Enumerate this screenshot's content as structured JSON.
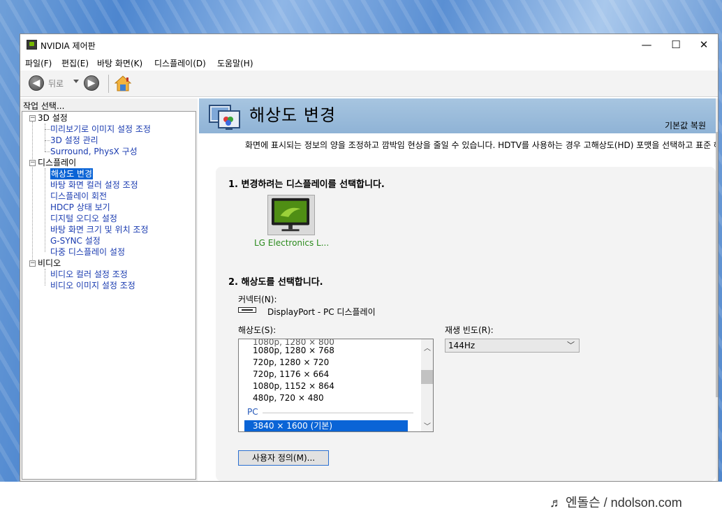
{
  "window": {
    "title": "NVIDIA 제어판",
    "controls": {
      "minimize": "—",
      "maximize": "☐",
      "close": "✕"
    }
  },
  "menu": [
    "파일(F)",
    "편집(E)",
    "바탕 화면(K)",
    "디스플레이(D)",
    "도움말(H)"
  ],
  "toolbar": {
    "back_label": "뒤로",
    "back_icon": "◀",
    "forward_icon": "▶"
  },
  "left_pane": {
    "title": "작업 선택...",
    "tree": [
      {
        "label": "3D 설정",
        "children": [
          "미리보기로 이미지 설정 조정",
          "3D 설정 관리",
          "Surround, PhysX 구성"
        ]
      },
      {
        "label": "디스플레이",
        "children": [
          "해상도 변경",
          "바탕 화면 컬러 설정 조정",
          "디스플레이 회전",
          "HDCP 상태 보기",
          "디지털 오디오 설정",
          "바탕 화면 크기 및 위치 조정",
          "G-SYNC 설정",
          "다중 디스플레이 설정"
        ]
      },
      {
        "label": "비디오",
        "children": [
          "비디오 컬러 설정 조정",
          "비디오 이미지 설정 조정"
        ]
      }
    ],
    "selected": "해상도 변경"
  },
  "page": {
    "title": "해상도 변경",
    "restore_link": "기본값 복원",
    "description": "화면에 표시되는 정보의 양을 조정하고 깜박임 현상을 줄일 수 있습니다. HDTV를 사용하는 경우 고해상도(HD) 포맷을 선택하고 표준 해",
    "section1": "1. 변경하려는 디스플레이를 선택합니다.",
    "display_name": "LG Electronics L...",
    "section2": "2. 해상도를 선택합니다.",
    "connector_label": "커넥터(N):",
    "connector_value": "DisplayPort - PC 디스플레이",
    "resolution_label": "해상도(S):",
    "resolution_items": [
      "1080p, 1280 × 768",
      "720p, 1280 × 720",
      "720p, 1176 × 664",
      "1080p, 1152 × 864",
      "480p, 720 × 480"
    ],
    "resolution_group": "PC",
    "resolution_selected": "3840 × 1600 (기본)",
    "refresh_label": "재생 빈도(R):",
    "refresh_value": "144Hz",
    "custom_button": "사용자 정의(M)..."
  },
  "watermark": "♬ 엔돌슨 / ndolson.com",
  "colors": {
    "accent": "#0a64d6",
    "nvidia_green": "#76b900",
    "banner": "#9bbddb"
  }
}
